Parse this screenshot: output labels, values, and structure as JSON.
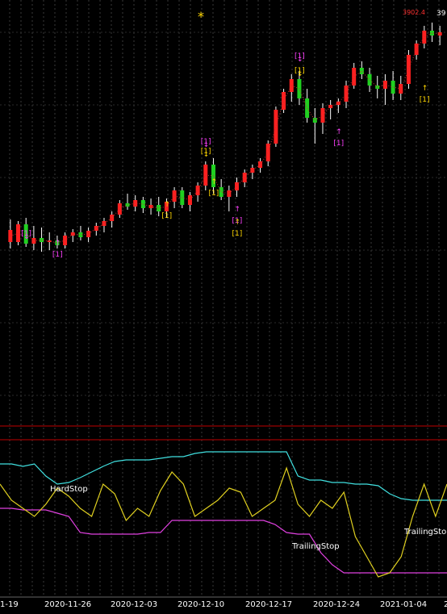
{
  "chart_data": [
    {
      "type": "candlestick",
      "title": "",
      "markers": {
        "signal_label": "[1]",
        "top_star": "*",
        "price_top_label": "3902.4",
        "price_top_label2": "39"
      },
      "candles": [
        {
          "o": 285,
          "h": 272,
          "l": 308,
          "c": 300,
          "up": true
        },
        {
          "o": 300,
          "h": 274,
          "l": 304,
          "c": 278,
          "up": true
        },
        {
          "o": 278,
          "h": 270,
          "l": 306,
          "c": 302,
          "up": false
        },
        {
          "o": 302,
          "h": 280,
          "l": 310,
          "c": 295,
          "up": true
        },
        {
          "o": 295,
          "h": 282,
          "l": 312,
          "c": 300,
          "up": false
        },
        {
          "o": 300,
          "h": 288,
          "l": 310,
          "c": 298,
          "up": true
        },
        {
          "o": 298,
          "h": 292,
          "l": 308,
          "c": 304,
          "up": false
        },
        {
          "o": 304,
          "h": 288,
          "l": 308,
          "c": 292,
          "up": true
        },
        {
          "o": 292,
          "h": 284,
          "l": 300,
          "c": 288,
          "up": true
        },
        {
          "o": 288,
          "h": 280,
          "l": 298,
          "c": 294,
          "up": false
        },
        {
          "o": 294,
          "h": 282,
          "l": 300,
          "c": 286,
          "up": true
        },
        {
          "o": 286,
          "h": 276,
          "l": 292,
          "c": 280,
          "up": true
        },
        {
          "o": 280,
          "h": 270,
          "l": 288,
          "c": 274,
          "up": true
        },
        {
          "o": 274,
          "h": 262,
          "l": 282,
          "c": 266,
          "up": true
        },
        {
          "o": 266,
          "h": 248,
          "l": 270,
          "c": 252,
          "up": true
        },
        {
          "o": 252,
          "h": 240,
          "l": 260,
          "c": 256,
          "up": false
        },
        {
          "o": 256,
          "h": 242,
          "l": 262,
          "c": 248,
          "up": true
        },
        {
          "o": 248,
          "h": 244,
          "l": 264,
          "c": 258,
          "up": false
        },
        {
          "o": 258,
          "h": 246,
          "l": 266,
          "c": 254,
          "up": true
        },
        {
          "o": 254,
          "h": 244,
          "l": 268,
          "c": 262,
          "up": false
        },
        {
          "o": 262,
          "h": 246,
          "l": 270,
          "c": 250,
          "up": true
        },
        {
          "o": 250,
          "h": 232,
          "l": 258,
          "c": 236,
          "up": true
        },
        {
          "o": 236,
          "h": 232,
          "l": 258,
          "c": 254,
          "up": false
        },
        {
          "o": 254,
          "h": 238,
          "l": 262,
          "c": 242,
          "up": true
        },
        {
          "o": 242,
          "h": 226,
          "l": 250,
          "c": 230,
          "up": true
        },
        {
          "o": 230,
          "h": 200,
          "l": 236,
          "c": 204,
          "up": true
        },
        {
          "o": 204,
          "h": 196,
          "l": 240,
          "c": 232,
          "up": false
        },
        {
          "o": 232,
          "h": 222,
          "l": 248,
          "c": 244,
          "up": false
        },
        {
          "o": 244,
          "h": 230,
          "l": 262,
          "c": 236,
          "up": true
        },
        {
          "o": 236,
          "h": 220,
          "l": 244,
          "c": 226,
          "up": true
        },
        {
          "o": 226,
          "h": 210,
          "l": 232,
          "c": 214,
          "up": true
        },
        {
          "o": 214,
          "h": 204,
          "l": 222,
          "c": 208,
          "up": true
        },
        {
          "o": 208,
          "h": 196,
          "l": 214,
          "c": 200,
          "up": true
        },
        {
          "o": 200,
          "h": 174,
          "l": 206,
          "c": 178,
          "up": true
        },
        {
          "o": 178,
          "h": 132,
          "l": 182,
          "c": 136,
          "up": true
        },
        {
          "o": 136,
          "h": 110,
          "l": 140,
          "c": 114,
          "up": true
        },
        {
          "o": 114,
          "h": 92,
          "l": 126,
          "c": 98,
          "up": true
        },
        {
          "o": 98,
          "h": 88,
          "l": 130,
          "c": 122,
          "up": false
        },
        {
          "o": 122,
          "h": 110,
          "l": 152,
          "c": 146,
          "up": false
        },
        {
          "o": 146,
          "h": 134,
          "l": 178,
          "c": 152,
          "up": false
        },
        {
          "o": 152,
          "h": 128,
          "l": 166,
          "c": 134,
          "up": true
        },
        {
          "o": 134,
          "h": 124,
          "l": 148,
          "c": 130,
          "up": true
        },
        {
          "o": 130,
          "h": 122,
          "l": 140,
          "c": 126,
          "up": true
        },
        {
          "o": 126,
          "h": 100,
          "l": 134,
          "c": 106,
          "up": true
        },
        {
          "o": 106,
          "h": 78,
          "l": 110,
          "c": 84,
          "up": true
        },
        {
          "o": 84,
          "h": 76,
          "l": 98,
          "c": 92,
          "up": false
        },
        {
          "o": 92,
          "h": 84,
          "l": 114,
          "c": 106,
          "up": false
        },
        {
          "o": 106,
          "h": 94,
          "l": 122,
          "c": 110,
          "up": false
        },
        {
          "o": 110,
          "h": 92,
          "l": 130,
          "c": 100,
          "up": true
        },
        {
          "o": 100,
          "h": 88,
          "l": 124,
          "c": 116,
          "up": false
        },
        {
          "o": 116,
          "h": 94,
          "l": 124,
          "c": 104,
          "up": true
        },
        {
          "o": 104,
          "h": 62,
          "l": 110,
          "c": 68,
          "up": true
        },
        {
          "o": 68,
          "h": 50,
          "l": 74,
          "c": 54,
          "up": true
        },
        {
          "o": 54,
          "h": 32,
          "l": 60,
          "c": 38,
          "up": true
        },
        {
          "o": 38,
          "h": 28,
          "l": 52,
          "c": 44,
          "up": false
        },
        {
          "o": 44,
          "h": 32,
          "l": 56,
          "c": 40,
          "up": true
        }
      ],
      "oscillator": {
        "labels": {
          "hard_stop": "HardStop",
          "trailing_stop_1": "TrailingStop",
          "trailing_stop_2": "TrailingSto"
        },
        "cyan": [
          575,
          575,
          578,
          575,
          590,
          600,
          598,
          592,
          585,
          578,
          572,
          570,
          570,
          570,
          568,
          566,
          566,
          562,
          560,
          560,
          560,
          560,
          560,
          560,
          560,
          560,
          590,
          595,
          595,
          598,
          598,
          600,
          600,
          602,
          612,
          618,
          620,
          620,
          620,
          620
        ],
        "magenta": [
          630,
          630,
          632,
          632,
          632,
          636,
          640,
          660,
          662,
          662,
          662,
          662,
          662,
          660,
          660,
          645,
          645,
          645,
          645,
          645,
          645,
          645,
          645,
          645,
          650,
          660,
          662,
          662,
          685,
          700,
          710,
          710,
          710,
          710,
          710,
          710,
          710,
          710,
          710,
          710
        ],
        "yellow": [
          600,
          620,
          630,
          640,
          625,
          605,
          615,
          630,
          640,
          600,
          612,
          645,
          630,
          640,
          608,
          585,
          600,
          640,
          630,
          620,
          605,
          610,
          640,
          630,
          620,
          580,
          625,
          640,
          620,
          630,
          610,
          665,
          690,
          715,
          710,
          690,
          640,
          600,
          640,
          600
        ]
      },
      "x_tick_labels": [
        "1-19",
        "2020-11-26",
        "2020-12-03",
        "2020-12-10",
        "2020-12-17",
        "2020-12-24",
        "2021-01-04",
        "2"
      ]
    }
  ]
}
